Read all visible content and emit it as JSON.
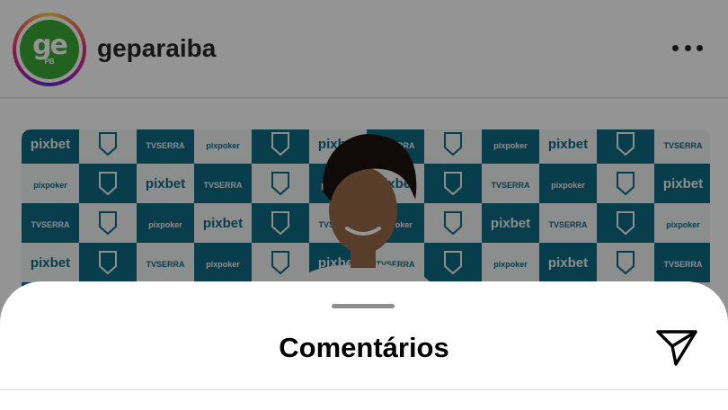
{
  "post": {
    "username": "geparaiba",
    "avatar_logo": {
      "main": "ge",
      "sub": "PB"
    },
    "more_icon": "more-horizontal-icon"
  },
  "photo": {
    "backdrop_text": {
      "brand_a": "pixbet",
      "brand_b": "TVSERRA",
      "brand_c": "pixpoker"
    },
    "colors": {
      "teal": "#0e6a82",
      "white": "#f2f4f4",
      "shirt": "#f5f5f5",
      "skin": "#9a6a4b",
      "hair": "#1c140f"
    }
  },
  "sheet": {
    "title": "Comentários",
    "send_icon": "send-icon"
  }
}
